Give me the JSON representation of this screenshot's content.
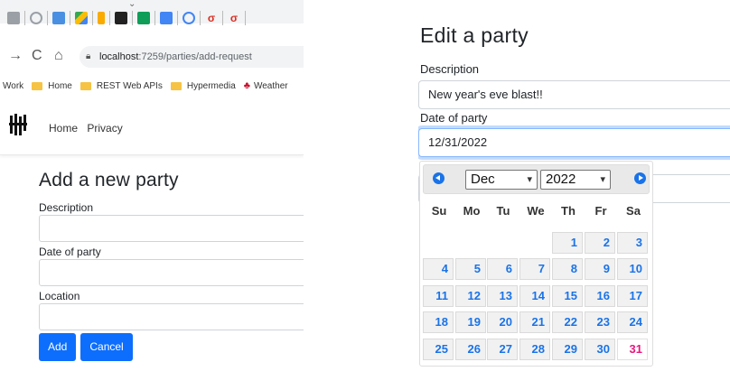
{
  "left": {
    "url": {
      "host": "localhost",
      "path": ":7259/parties/add-request"
    },
    "bookmarks": [
      "Work",
      "Home",
      "REST Web APIs",
      "Hypermedia",
      "Weather"
    ],
    "site_nav": [
      "Home",
      "Privacy"
    ],
    "form": {
      "title": "Add a new party",
      "fields": [
        "Description",
        "Date of party",
        "Location"
      ],
      "add_label": "Add",
      "cancel_label": "Cancel"
    }
  },
  "right": {
    "title": "Edit a party",
    "description_label": "Description",
    "description_value": "New year's eve blast!!",
    "date_label": "Date of party",
    "date_value": "12/31/2022",
    "datepicker": {
      "month": "Dec",
      "year": "2022",
      "weekdays": [
        "Su",
        "Mo",
        "Tu",
        "We",
        "Th",
        "Fr",
        "Sa"
      ],
      "days": [
        "1",
        "2",
        "3",
        "4",
        "5",
        "6",
        "7",
        "8",
        "9",
        "10",
        "11",
        "12",
        "13",
        "14",
        "15",
        "16",
        "17",
        "18",
        "19",
        "20",
        "21",
        "22",
        "23",
        "24",
        "25",
        "26",
        "27",
        "28",
        "29",
        "30",
        "31"
      ],
      "selected": "31"
    }
  },
  "colors": {
    "primary": "#0d6efd",
    "calendar_day": "#1a73e8",
    "selected_day": "#e8177d",
    "focus_border": "#86b7fe"
  },
  "icons": [
    "back-arrow-icon",
    "reload-icon",
    "home-icon",
    "lock-icon",
    "folder-icon",
    "maple-leaf-icon",
    "site-logo-icon",
    "prev-month-icon",
    "next-month-icon",
    "chevron-down-icon"
  ]
}
